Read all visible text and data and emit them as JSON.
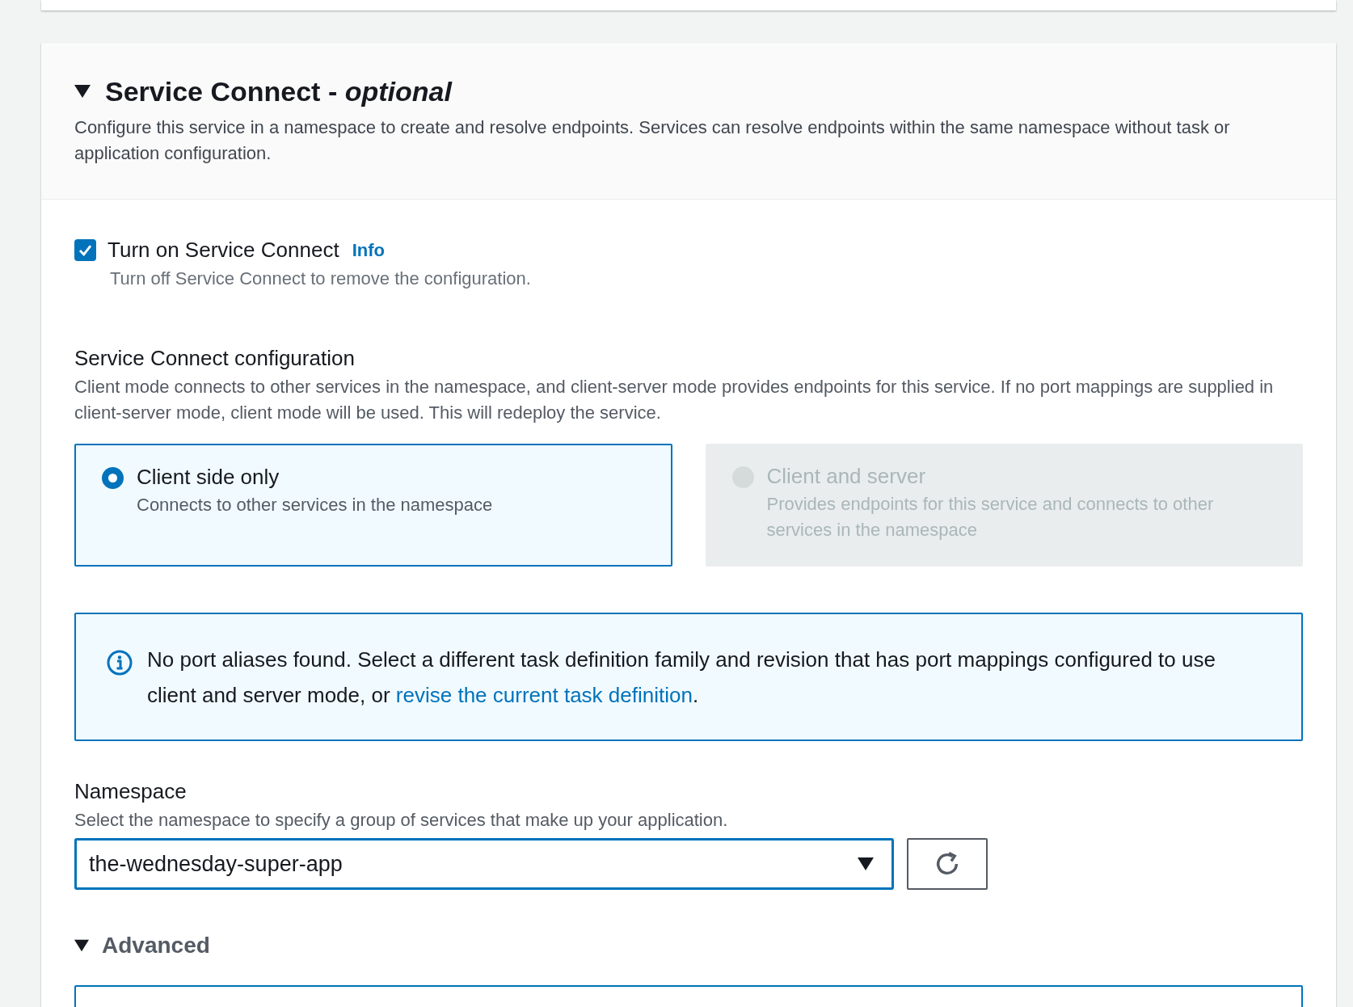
{
  "section": {
    "title": "Service Connect - *optional*",
    "expanded": true,
    "description": "Configure this service in a namespace to create and resolve endpoints. Services can resolve endpoints within the same namespace without task or application configuration."
  },
  "toggle": {
    "label": "Turn on Service Connect",
    "info": "Info",
    "checked": true,
    "hint": "Turn off Service Connect to remove the configuration."
  },
  "config": {
    "label": "Service Connect configuration",
    "description": "Client mode connects to other services in the namespace, and client-server mode provides endpoints for this service. If no port mappings are supplied in client-server mode, client mode will be used. This will redeploy the service.",
    "options": [
      {
        "title": "Client side only",
        "description": "Connects to other services in the namespace",
        "selected": true,
        "disabled": false
      },
      {
        "title": "Client and server",
        "description": "Provides endpoints for this service and connects to other services in the namespace",
        "selected": false,
        "disabled": true
      }
    ]
  },
  "alert": {
    "text": "No port aliases found. Select a different task definition family and revision that has port mappings configured to use client and server mode, or",
    "link": "revise the current task definition",
    "end": "."
  },
  "namespace": {
    "label": "Namespace",
    "description": "Select the namespace to specify a group of services that make up your application.",
    "value": "the-wednesday-super-app"
  },
  "advanced": {
    "label": "Advanced",
    "expanded": true
  }
}
